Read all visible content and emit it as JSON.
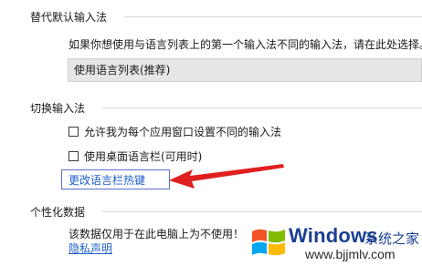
{
  "sections": {
    "override": {
      "header": "替代默认输入法",
      "description": "如果你想使用与语言列表上的第一个输入法不同的输入法，请在此处选择。",
      "dropdown_value": "使用语言列表(推荐)"
    },
    "switching": {
      "header": "切换输入法",
      "checkbox_per_app": "允许我为每个应用窗口设置不同的输入法",
      "checkbox_desktop_bar": "使用桌面语言栏(可用时)",
      "hotkeys_link": "更改语言栏热键"
    },
    "personalization": {
      "header": "个性化数据",
      "description": "该数据仅用于在此电脑上为不使用！",
      "privacy_link": "隐私声明"
    }
  },
  "watermark": {
    "brand": "Windows",
    "brand_cn": "系统之家",
    "url": "www.bjjmlv.com",
    "logo_colors": [
      "#f35325",
      "#81bc06",
      "#05a6f0",
      "#ffba08"
    ]
  },
  "colors": {
    "link": "#1e5fc9",
    "arrow": "#e02020",
    "highlight_box": "#5a6fd6",
    "dropdown_bg": "#e6e6e6"
  }
}
